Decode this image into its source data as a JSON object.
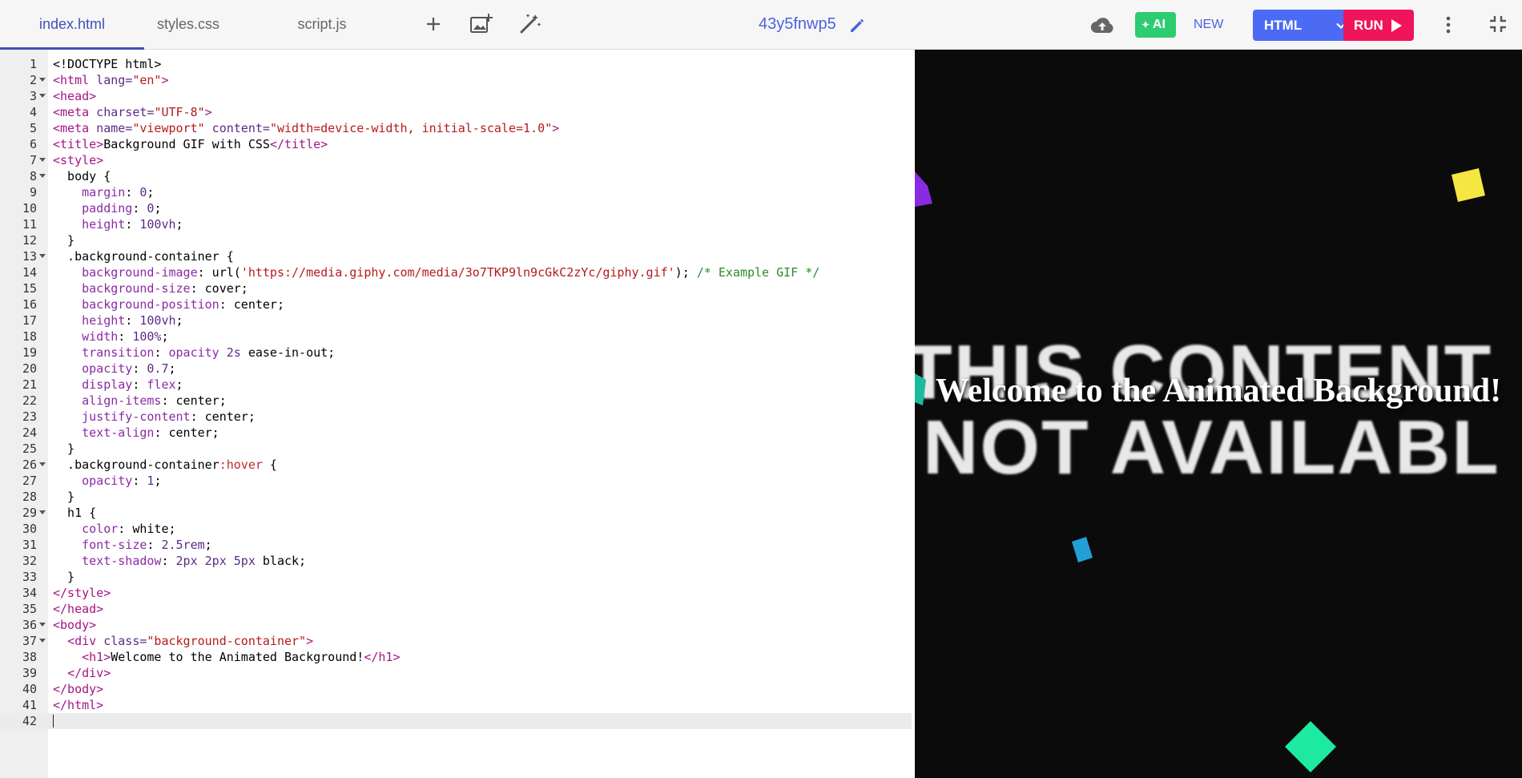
{
  "tabs": [
    {
      "label": "index.html",
      "active": true
    },
    {
      "label": "styles.css",
      "active": false
    },
    {
      "label": "script.js",
      "active": false
    }
  ],
  "toolbar": {
    "project_name": "43y5fnwp5",
    "ai_label": "AI",
    "new_label": "NEW",
    "language_label": "HTML",
    "run_label": "RUN"
  },
  "editor": {
    "current_line": 42,
    "lines": [
      [
        {
          "c": "plain",
          "t": "<!DOCTYPE html>"
        }
      ],
      [
        {
          "c": "tag",
          "t": "<html"
        },
        {
          "c": "attr",
          "t": " lang="
        },
        {
          "c": "str",
          "t": "\"en\""
        },
        {
          "c": "tag",
          "t": ">"
        }
      ],
      [
        {
          "c": "tag",
          "t": "<head>"
        }
      ],
      [
        {
          "c": "tag",
          "t": "<meta"
        },
        {
          "c": "attr",
          "t": " charset="
        },
        {
          "c": "str",
          "t": "\"UTF-8\""
        },
        {
          "c": "tag",
          "t": ">"
        }
      ],
      [
        {
          "c": "tag",
          "t": "<meta"
        },
        {
          "c": "attr",
          "t": " name="
        },
        {
          "c": "str",
          "t": "\"viewport\""
        },
        {
          "c": "attr",
          "t": " content="
        },
        {
          "c": "str",
          "t": "\"width=device-width, initial-scale=1.0\""
        },
        {
          "c": "tag",
          "t": ">"
        }
      ],
      [
        {
          "c": "tag",
          "t": "<title>"
        },
        {
          "c": "plain",
          "t": "Background GIF with CSS"
        },
        {
          "c": "tag",
          "t": "</title>"
        }
      ],
      [
        {
          "c": "tag",
          "t": "<style>"
        }
      ],
      [
        {
          "c": "plain",
          "t": "  body {"
        }
      ],
      [
        {
          "c": "plain",
          "t": "    "
        },
        {
          "c": "prop",
          "t": "margin"
        },
        {
          "c": "plain",
          "t": ": "
        },
        {
          "c": "num",
          "t": "0"
        },
        {
          "c": "plain",
          "t": ";"
        }
      ],
      [
        {
          "c": "plain",
          "t": "    "
        },
        {
          "c": "prop",
          "t": "padding"
        },
        {
          "c": "plain",
          "t": ": "
        },
        {
          "c": "num",
          "t": "0"
        },
        {
          "c": "plain",
          "t": ";"
        }
      ],
      [
        {
          "c": "plain",
          "t": "    "
        },
        {
          "c": "prop",
          "t": "height"
        },
        {
          "c": "plain",
          "t": ": "
        },
        {
          "c": "num",
          "t": "100vh"
        },
        {
          "c": "plain",
          "t": ";"
        }
      ],
      [
        {
          "c": "plain",
          "t": "  }"
        }
      ],
      [
        {
          "c": "plain",
          "t": "  .background-container {"
        }
      ],
      [
        {
          "c": "plain",
          "t": "    "
        },
        {
          "c": "prop",
          "t": "background-image"
        },
        {
          "c": "plain",
          "t": ": url("
        },
        {
          "c": "str",
          "t": "'https://media.giphy.com/media/3o7TKP9ln9cGkC2zYc/giphy.gif'"
        },
        {
          "c": "plain",
          "t": "); "
        },
        {
          "c": "cmt",
          "t": "/* Example GIF */"
        }
      ],
      [
        {
          "c": "plain",
          "t": "    "
        },
        {
          "c": "prop",
          "t": "background-size"
        },
        {
          "c": "plain",
          "t": ": cover;"
        }
      ],
      [
        {
          "c": "plain",
          "t": "    "
        },
        {
          "c": "prop",
          "t": "background-position"
        },
        {
          "c": "plain",
          "t": ": center;"
        }
      ],
      [
        {
          "c": "plain",
          "t": "    "
        },
        {
          "c": "prop",
          "t": "height"
        },
        {
          "c": "plain",
          "t": ": "
        },
        {
          "c": "num",
          "t": "100vh"
        },
        {
          "c": "plain",
          "t": ";"
        }
      ],
      [
        {
          "c": "plain",
          "t": "    "
        },
        {
          "c": "prop",
          "t": "width"
        },
        {
          "c": "plain",
          "t": ": "
        },
        {
          "c": "num",
          "t": "100%"
        },
        {
          "c": "plain",
          "t": ";"
        }
      ],
      [
        {
          "c": "plain",
          "t": "    "
        },
        {
          "c": "prop",
          "t": "transition"
        },
        {
          "c": "plain",
          "t": ": "
        },
        {
          "c": "prop",
          "t": "opacity"
        },
        {
          "c": "plain",
          "t": " "
        },
        {
          "c": "num",
          "t": "2s"
        },
        {
          "c": "plain",
          "t": " ease-in-out;"
        }
      ],
      [
        {
          "c": "plain",
          "t": "    "
        },
        {
          "c": "prop",
          "t": "opacity"
        },
        {
          "c": "plain",
          "t": ": "
        },
        {
          "c": "num",
          "t": "0.7"
        },
        {
          "c": "plain",
          "t": ";"
        }
      ],
      [
        {
          "c": "plain",
          "t": "    "
        },
        {
          "c": "prop",
          "t": "display"
        },
        {
          "c": "plain",
          "t": ": "
        },
        {
          "c": "prop",
          "t": "flex"
        },
        {
          "c": "plain",
          "t": ";"
        }
      ],
      [
        {
          "c": "plain",
          "t": "    "
        },
        {
          "c": "prop",
          "t": "align-items"
        },
        {
          "c": "plain",
          "t": ": center;"
        }
      ],
      [
        {
          "c": "plain",
          "t": "    "
        },
        {
          "c": "prop",
          "t": "justify-content"
        },
        {
          "c": "plain",
          "t": ": center;"
        }
      ],
      [
        {
          "c": "plain",
          "t": "    "
        },
        {
          "c": "prop",
          "t": "text-align"
        },
        {
          "c": "plain",
          "t": ": center;"
        }
      ],
      [
        {
          "c": "plain",
          "t": "  }"
        }
      ],
      [
        {
          "c": "plain",
          "t": "  .background-container"
        },
        {
          "c": "pseudo",
          "t": ":hover"
        },
        {
          "c": "plain",
          "t": " {"
        }
      ],
      [
        {
          "c": "plain",
          "t": "    "
        },
        {
          "c": "prop",
          "t": "opacity"
        },
        {
          "c": "plain",
          "t": ": "
        },
        {
          "c": "num",
          "t": "1"
        },
        {
          "c": "plain",
          "t": ";"
        }
      ],
      [
        {
          "c": "plain",
          "t": "  }"
        }
      ],
      [
        {
          "c": "plain",
          "t": "  h1 {"
        }
      ],
      [
        {
          "c": "plain",
          "t": "    "
        },
        {
          "c": "prop",
          "t": "color"
        },
        {
          "c": "plain",
          "t": ": white;"
        }
      ],
      [
        {
          "c": "plain",
          "t": "    "
        },
        {
          "c": "prop",
          "t": "font-size"
        },
        {
          "c": "plain",
          "t": ": "
        },
        {
          "c": "num",
          "t": "2.5rem"
        },
        {
          "c": "plain",
          "t": ";"
        }
      ],
      [
        {
          "c": "plain",
          "t": "    "
        },
        {
          "c": "prop",
          "t": "text-shadow"
        },
        {
          "c": "plain",
          "t": ": "
        },
        {
          "c": "num",
          "t": "2px 2px 5px"
        },
        {
          "c": "plain",
          "t": " black;"
        }
      ],
      [
        {
          "c": "plain",
          "t": "  }"
        }
      ],
      [
        {
          "c": "tag",
          "t": "</style>"
        }
      ],
      [
        {
          "c": "tag",
          "t": "</head>"
        }
      ],
      [
        {
          "c": "tag",
          "t": "<body>"
        }
      ],
      [
        {
          "c": "plain",
          "t": "  "
        },
        {
          "c": "tag",
          "t": "<div"
        },
        {
          "c": "attr",
          "t": " class="
        },
        {
          "c": "str",
          "t": "\"background-container\""
        },
        {
          "c": "tag",
          "t": ">"
        }
      ],
      [
        {
          "c": "plain",
          "t": "    "
        },
        {
          "c": "tag",
          "t": "<h1>"
        },
        {
          "c": "plain",
          "t": "Welcome to the Animated Background!"
        },
        {
          "c": "tag",
          "t": "</h1>"
        }
      ],
      [
        {
          "c": "plain",
          "t": "  "
        },
        {
          "c": "tag",
          "t": "</div>"
        }
      ],
      [
        {
          "c": "tag",
          "t": "</body>"
        }
      ],
      [
        {
          "c": "tag",
          "t": "</html>"
        }
      ],
      []
    ],
    "fold_lines": [
      2,
      3,
      7,
      8,
      13,
      26,
      29,
      36,
      37
    ]
  },
  "preview": {
    "background_text": [
      "THIS CONTENT",
      "NOT AVAILABL"
    ],
    "heading": "Welcome to the Animated Background!",
    "confetti_colors": [
      "#8a2be2",
      "#f5e642",
      "#1abc9c",
      "#21a0d8",
      "#1de9a0"
    ]
  },
  "colors": {
    "accent": "#3f51b5",
    "ai": "#2ecc71",
    "html_button": "#4b6bf5",
    "run_button": "#f0145a"
  }
}
